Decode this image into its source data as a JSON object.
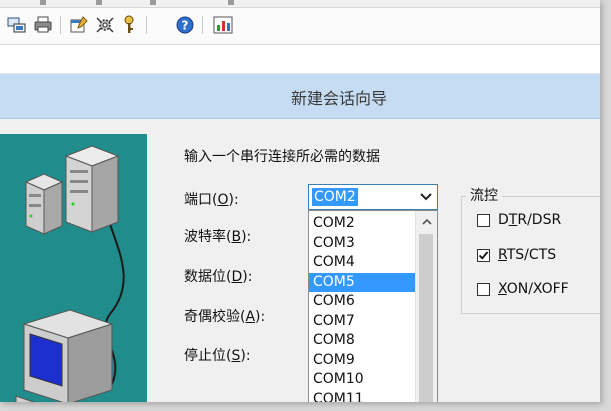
{
  "dialog": {
    "title": "新建会话向导",
    "instruction": "输入一个串行连接所必需的数据"
  },
  "fields": {
    "port": {
      "pre": "端口(",
      "key": "O",
      "post": "):"
    },
    "baud": {
      "pre": "波特率(",
      "key": "B",
      "post": "):"
    },
    "databits": {
      "pre": "数据位(",
      "key": "D",
      "post": "):"
    },
    "parity": {
      "pre": "奇偶校验(",
      "key": "A",
      "post": "):"
    },
    "stopbits": {
      "pre": "停止位(",
      "key": "S",
      "post": "):"
    }
  },
  "port_combo": {
    "value": "COM2",
    "options": [
      "COM2",
      "COM3",
      "COM4",
      "COM5",
      "COM6",
      "COM7",
      "COM8",
      "COM9",
      "COM10",
      "COM11"
    ],
    "highlighted": "COM5"
  },
  "flow_control": {
    "title": "流控",
    "options": [
      {
        "pre": "D",
        "key": "T",
        "post": "R/DSR",
        "checked": false
      },
      {
        "pre": "",
        "key": "R",
        "post": "TS/CTS",
        "checked": true
      },
      {
        "pre": "",
        "key": "X",
        "post": "ON/XOFF",
        "checked": false
      }
    ]
  },
  "icons": {
    "toolbar": [
      "connect-icon",
      "print-icon",
      "properties-icon",
      "settings-icon",
      "key-icon",
      "help-icon",
      "chart-icon"
    ],
    "combo_arrow": "chevron-down-icon",
    "scroll_up": "chevron-up-icon",
    "checkmark": "check-icon"
  },
  "colors": {
    "title_bar": "#c5dcf2",
    "selection": "#3399ff",
    "illustration_bg": "#218c8c"
  }
}
